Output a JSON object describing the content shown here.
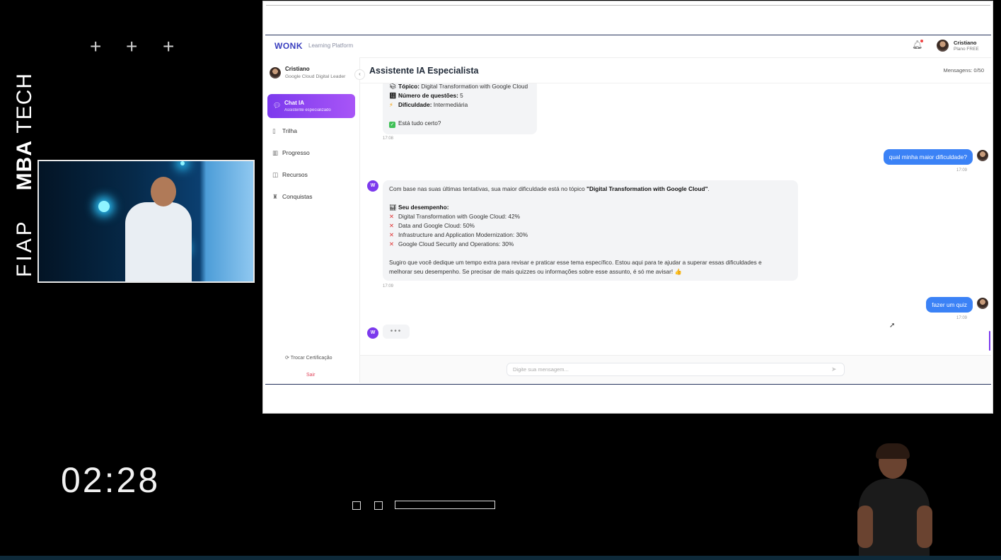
{
  "overlay": {
    "brand_fiap": "FIAP",
    "brand_mba": "MBA",
    "brand_tech": "TECH",
    "timer": "02:28"
  },
  "app": {
    "logo": "WONK",
    "logo_subtitle": "Learning Platform",
    "user_name": "Cristiano",
    "user_plan": "Plano FREE"
  },
  "sidebar": {
    "profile_name": "Cristiano",
    "profile_role": "Google Cloud Digital Leader",
    "active_item": {
      "label": "Chat IA",
      "sublabel": "Assistente especializado"
    },
    "items": [
      {
        "label": "Trilha",
        "icon": "book-icon"
      },
      {
        "label": "Progresso",
        "icon": "bar-chart-icon"
      },
      {
        "label": "Recursos",
        "icon": "book-open-icon"
      },
      {
        "label": "Conquistas",
        "icon": "trophy-icon"
      }
    ],
    "switch_cert": "Trocar Certificação",
    "logout": "Sair"
  },
  "main": {
    "title": "Assistente IA Especialista",
    "message_count": "Mensagens: 0/50"
  },
  "chat": {
    "msg1": {
      "topic_label": "Tópico:",
      "topic_value": "Digital Transformation with Google Cloud",
      "questions_label": "Número de questões:",
      "questions_value": "5",
      "difficulty_label": "Dificuldade:",
      "difficulty_value": "Intermediária",
      "confirm": "Está tudo certo?",
      "time": "17:08"
    },
    "msg2": {
      "text": "qual minha maior dificuldade?",
      "time": "17:09"
    },
    "msg3": {
      "intro": "Com base nas suas últimas tentativas, sua maior dificuldade está no tópico ",
      "intro_topic": "\"Digital Transformation with Google Cloud\"",
      "intro_end": ".",
      "perf_title": "Seu desempenho:",
      "perf": [
        "Digital Transformation with Google Cloud: 42%",
        "Data and Google Cloud: 50%",
        "Infrastructure and Application Modernization: 30%",
        "Google Cloud Security and Operations: 30%"
      ],
      "closing_1": "Sugiro que você dedique um tempo extra para revisar e praticar esse tema específico. Estou aqui para te ajudar a superar essas dificuldades e",
      "closing_2": "melhorar seu desempenho. Se precisar de mais quizzes ou informações sobre esse assunto, é só me avisar! 👍",
      "time": "17:09"
    },
    "msg4": {
      "text": "fazer um quiz",
      "time": "17:09"
    },
    "bot_initial": "W",
    "typing": "•••"
  },
  "composer": {
    "placeholder": "Digite sua mensagem..."
  },
  "colors": {
    "accent": "#7c3aed",
    "user_bubble": "#3b82f6",
    "error": "#e03131"
  }
}
